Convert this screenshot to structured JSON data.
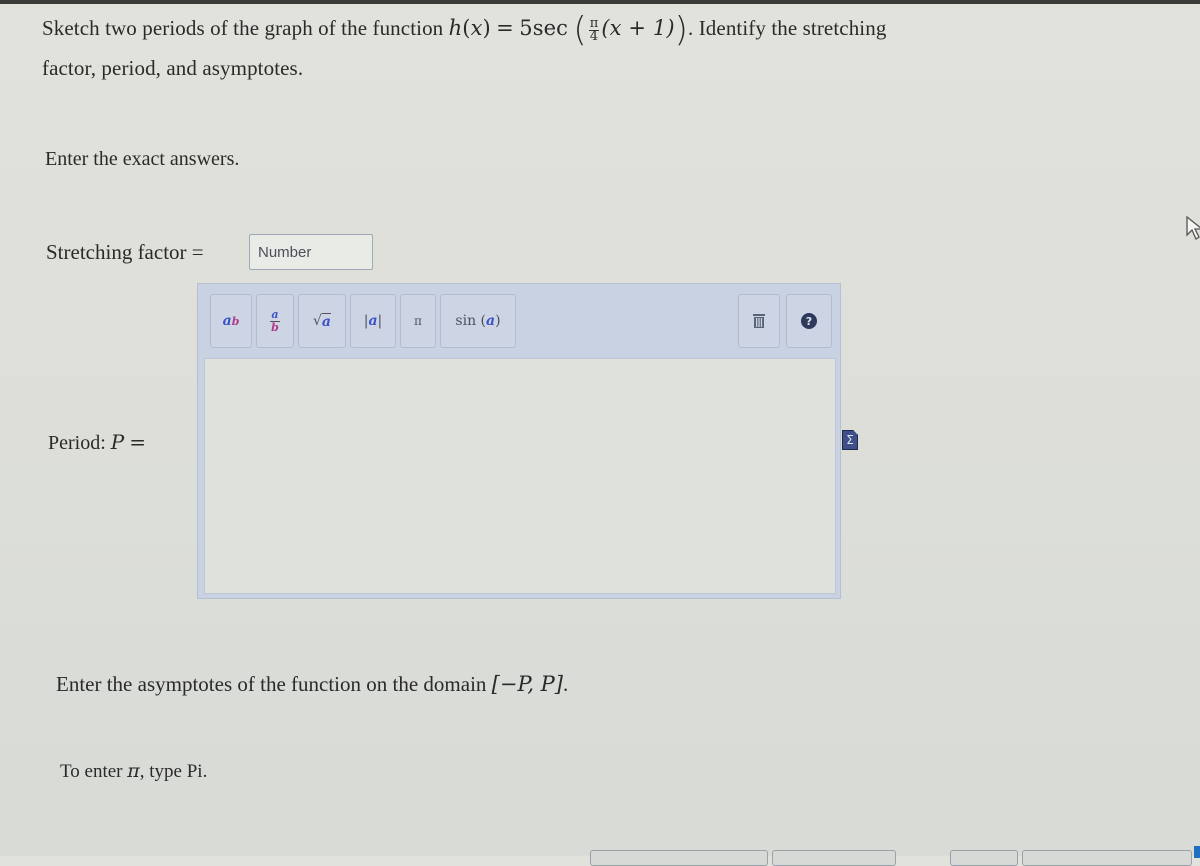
{
  "question": {
    "line1_prefix": "Sketch two periods of the graph of the function",
    "function_name": "h",
    "variable": "x",
    "equals": "=",
    "coefficient": "5",
    "trig": "sec",
    "fraction_num": "π",
    "fraction_den": "4",
    "inner_expr": "(x + 1)",
    "line1_suffix": ". Identify the stretching",
    "line2": "factor, period, and asymptotes."
  },
  "prompt": "Enter the exact answers.",
  "stretching_factor": {
    "label": "Stretching factor =",
    "placeholder": "Number",
    "value": ""
  },
  "editor": {
    "toolbar": [
      {
        "name": "power",
        "base": "a",
        "exp": "b"
      },
      {
        "name": "fraction",
        "num": "a",
        "den": "b"
      },
      {
        "name": "sqrt",
        "symbol": "√",
        "arg": "a"
      },
      {
        "name": "abs",
        "left": "|",
        "arg": "a",
        "right": "|"
      },
      {
        "name": "pi",
        "symbol": "π"
      },
      {
        "name": "sin",
        "fn": "sin",
        "arg": "a"
      }
    ],
    "delete_icon": "trash-icon",
    "help_icon": "help-icon",
    "value": ""
  },
  "period": {
    "label": "Period:",
    "var": "P",
    "eq": "="
  },
  "sigma_icon": "Σ",
  "asymptotes": {
    "text": "Enter the asymptotes of the function on the domain",
    "domain": "[−P, P]",
    "end": "."
  },
  "pi_hint": {
    "prefix": "To enter",
    "symbol": "π",
    "suffix": ", type Pi."
  }
}
